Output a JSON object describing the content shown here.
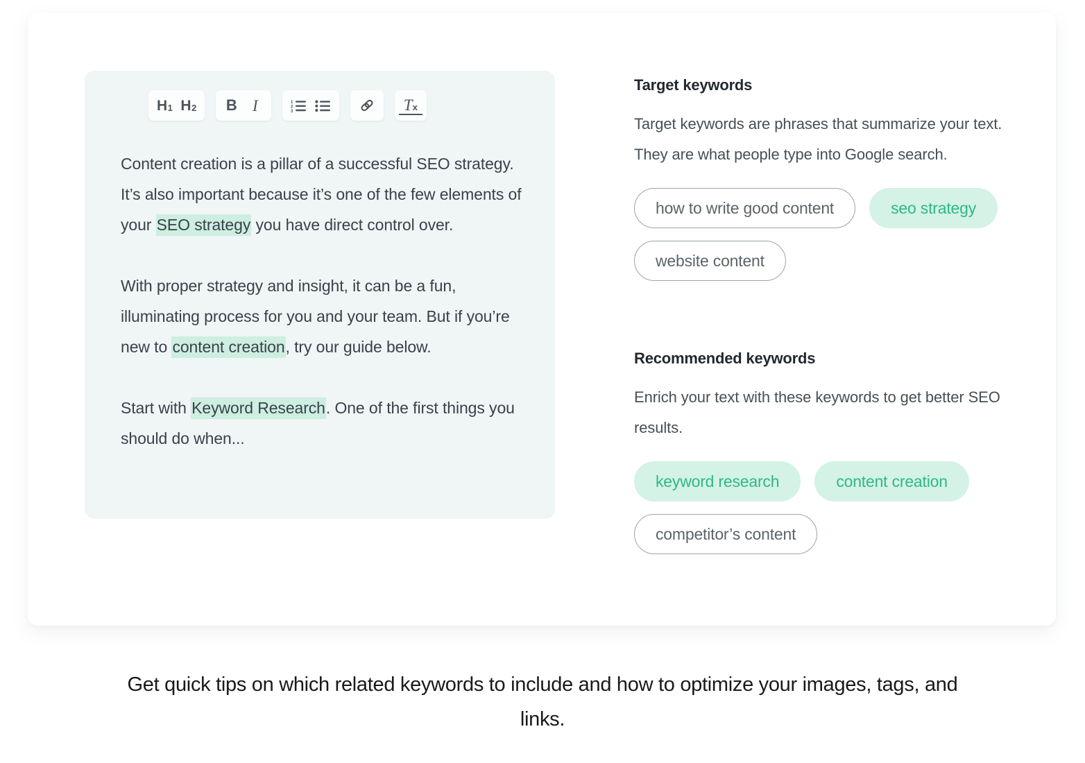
{
  "editor": {
    "toolbar": {
      "groups": [
        {
          "name": "headings",
          "buttons": [
            {
              "icon": "heading-1-icon",
              "label": "H",
              "sub": "1",
              "tooltip": "Heading 1"
            },
            {
              "icon": "heading-2-icon",
              "label": "H",
              "sub": "2",
              "tooltip": "Heading 2"
            }
          ]
        },
        {
          "name": "text-style",
          "buttons": [
            {
              "icon": "bold-icon",
              "label": "B",
              "tooltip": "Bold"
            },
            {
              "icon": "italic-icon",
              "label": "I",
              "tooltip": "Italic"
            }
          ]
        },
        {
          "name": "lists",
          "buttons": [
            {
              "icon": "ordered-list-icon",
              "label": "",
              "tooltip": "Numbered list"
            },
            {
              "icon": "bulleted-list-icon",
              "label": "",
              "tooltip": "Bulleted list"
            }
          ]
        },
        {
          "name": "link",
          "buttons": [
            {
              "icon": "link-icon",
              "label": "",
              "tooltip": "Insert link"
            }
          ]
        },
        {
          "name": "clear-formatting",
          "buttons": [
            {
              "icon": "clear-formatting-icon",
              "label": "T",
              "sub": "x",
              "tooltip": "Clear formatting"
            }
          ]
        }
      ]
    },
    "paragraphs": [
      {
        "id": "p1",
        "parts": [
          {
            "text": "Content creation is a pillar of a successful SEO strategy. It’s also important because it’s one of the few elements of your ",
            "highlight": false
          },
          {
            "text": "SEO strategy",
            "highlight": true
          },
          {
            "text": " you have direct control over.",
            "highlight": false
          }
        ]
      },
      {
        "id": "p2",
        "parts": [
          {
            "text": "With proper strategy and insight, it can be a fun, illuminating process for you and your team. But if you’re new to ",
            "highlight": false
          },
          {
            "text": "content creation",
            "highlight": true
          },
          {
            "text": ", try our guide below.",
            "highlight": false
          }
        ]
      },
      {
        "id": "p3",
        "parts": [
          {
            "text": "Start with ",
            "highlight": false
          },
          {
            "text": "Keyword Research",
            "highlight": true
          },
          {
            "text": ". One of the first things you should do when...",
            "highlight": false
          }
        ]
      }
    ]
  },
  "keywords_panel": {
    "target": {
      "title": "Target keywords",
      "description": "Target keywords are phrases that summarize your text. They are what people type into Google search.",
      "pills": [
        {
          "label": "how to write good content",
          "style": "outline"
        },
        {
          "label": "seo strategy",
          "style": "filled"
        },
        {
          "label": "website content",
          "style": "outline"
        }
      ]
    },
    "recommended": {
      "title": "Recommended keywords",
      "description": "Enrich your text with these keywords to get better SEO results.",
      "pills": [
        {
          "label": "keyword research",
          "style": "filled"
        },
        {
          "label": "content creation",
          "style": "filled"
        },
        {
          "label": "competitor’s content",
          "style": "outline"
        }
      ]
    }
  },
  "caption": {
    "text": "Get quick tips on which related keywords to include and how to optimize your images, tags, and links."
  },
  "colors": {
    "highlight_mint": "#cdeee1",
    "pill_filled_bg": "#d4f2e5",
    "pill_filled_text": "#2eb88a",
    "pill_outline_border": "#9aa5a0",
    "editor_bg": "#f0f5f6",
    "card_bg": "#ffffff",
    "body_text": "#39424a",
    "heading_text": "#222a2f"
  }
}
